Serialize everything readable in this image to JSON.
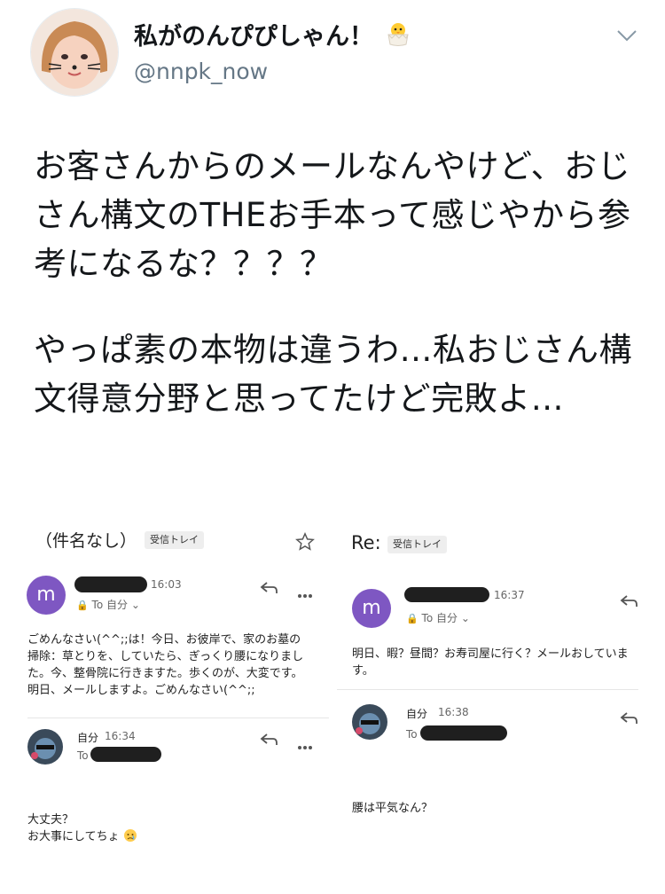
{
  "tweet": {
    "display_name": "私がのんぴぴしゃん！",
    "handle": "@nnpk_now",
    "paragraphs": [
      "お客さんからのメールなんやけど、おじさん構文のTHEお手本って感じやから参考になるな？？？？",
      "やっぱ素の本物は違うわ…私おじさん構文得意分野と思ってたけど完敗よ…"
    ]
  },
  "screenshot": {
    "left": {
      "subject": "（件名なし）",
      "label_tag": "受信トレイ",
      "email1": {
        "avatar_letter": "m",
        "time": "16:03",
        "to": "To 自分",
        "body": "ごめんなさい(^^;;は！今日、お彼岸で、家のお墓の掃除：草とりを、していたら、ぎっくり腰になりました。今、整骨院に行きますた。歩くのが、大変です。明日、メールしますよ。ごめんなさい(^^;;"
      },
      "reply1": {
        "sender": "自分",
        "time": "16:34",
        "to": "To",
        "body_line1": "大丈夫？",
        "body_line2": "お大事にしてちょ"
      }
    },
    "right": {
      "subject": "Re:",
      "label_tag": "受信トレイ",
      "email1": {
        "avatar_letter": "m",
        "time": "16:37",
        "to": "To 自分",
        "body": "明日、暇？昼間？お寿司屋に行く？メールおしています。"
      },
      "reply1": {
        "sender": "自分",
        "time": "16:38",
        "to": "To",
        "body": "腰は平気なん？"
      }
    }
  }
}
